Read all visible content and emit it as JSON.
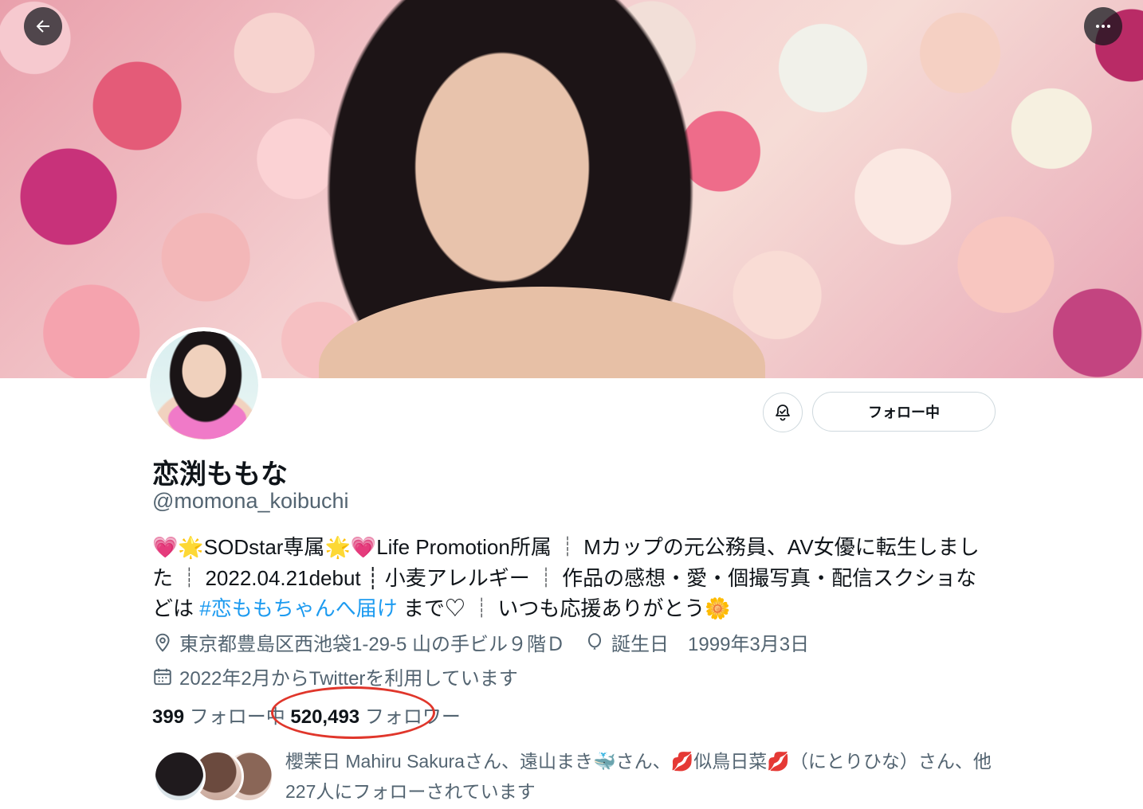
{
  "profile": {
    "name": "恋渕ももな",
    "handle": "@momona_koibuchi",
    "bio": {
      "heart_emoji": "💗",
      "star_emoji": "🌟",
      "text_1": "SODstar専属",
      "text_2": "Life Promotion所属 ┊ Mカップの元公務員、AV女優に転生しました ┊ 2022.04.21debut ┊ 小麦アレルギー ┊ 作品の感想・愛・個撮写真・配信スクショなどは ",
      "hashtag": "#恋ももちゃんへ届け",
      "text_3": " まで♡ ┊ いつも応援ありがとう",
      "flower_emoji": "🌼"
    },
    "location": "東京都豊島区西池袋1-29-5 山の手ビル９階Ｄ",
    "birthday_label": "誕生日",
    "birthday": "1999年3月3日",
    "joined": "2022年2月からTwitterを利用しています",
    "following_count": "399",
    "following_label": "フォロー中",
    "followers_count": "520,493",
    "followers_label": "フォロワー",
    "followed_by": "櫻茉日 Mahiru Sakuraさん、遠山まき🐳さん、💋似鳥日菜💋（にとりひな）さん、他227人にフォローされています"
  },
  "actions": {
    "follow_button": "フォロー中"
  },
  "icons": {
    "back": "back-arrow-icon",
    "more": "more-dots-icon",
    "notify": "notification-bell-icon",
    "location": "location-pin-icon",
    "birthday": "balloon-icon",
    "calendar": "calendar-icon"
  },
  "colors": {
    "link": "#1d9bf0",
    "secondary_text": "#536471",
    "annotation": "#e0362b"
  }
}
